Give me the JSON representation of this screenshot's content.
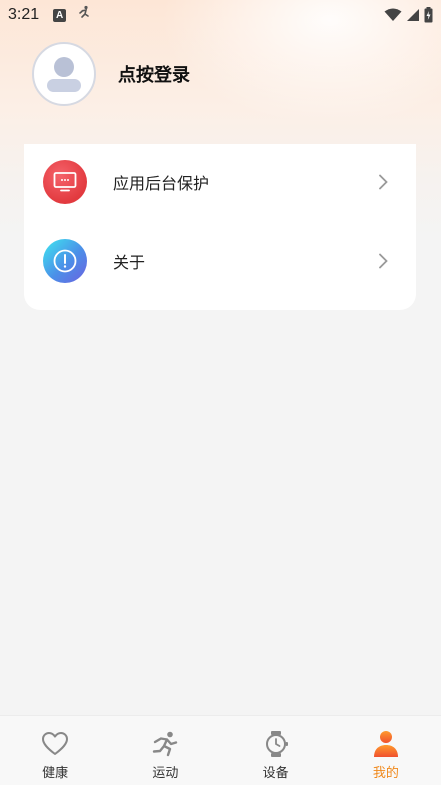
{
  "status_bar": {
    "time": "3:21",
    "notification_glyph": "A"
  },
  "profile": {
    "login_label": "点按登录"
  },
  "menu": {
    "items": [
      {
        "label": "应用后台保护",
        "icon": "monitor-icon",
        "color": "#e83c42"
      },
      {
        "label": "关于",
        "icon": "info-icon",
        "color": "#4b8fe8"
      }
    ]
  },
  "bottom_nav": {
    "items": [
      {
        "label": "健康",
        "icon": "heart-icon",
        "active": false
      },
      {
        "label": "运动",
        "icon": "running-icon",
        "active": false
      },
      {
        "label": "设备",
        "icon": "watch-icon",
        "active": false
      },
      {
        "label": "我的",
        "icon": "person-icon",
        "active": true
      }
    ],
    "active_color": "#f0891c"
  }
}
